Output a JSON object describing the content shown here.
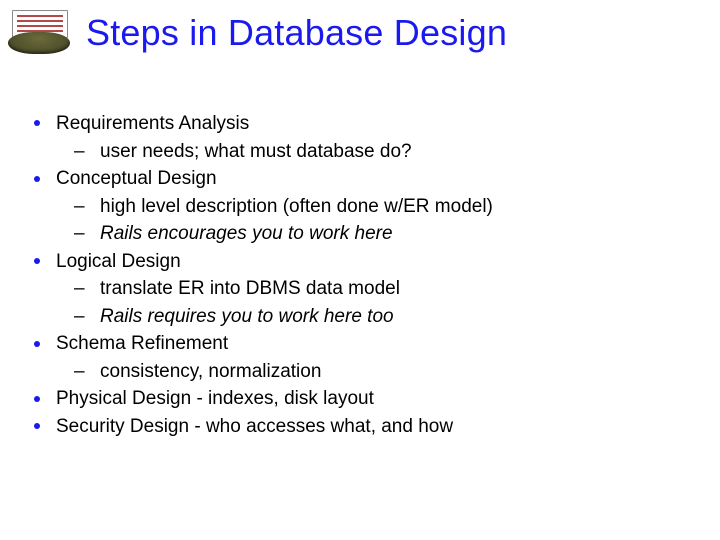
{
  "title": "Steps in Database Design",
  "bullets": {
    "b0": {
      "label": "Requirements Analysis",
      "sub": {
        "s0": "user needs; what must database do?"
      }
    },
    "b1": {
      "label": "Conceptual Design",
      "sub": {
        "s0": "high level description (often done w/ER model)",
        "s1": "Rails encourages you to work here"
      }
    },
    "b2": {
      "label": "Logical Design",
      "sub": {
        "s0": "translate ER into DBMS data model",
        "s1": "Rails requires you to work here too"
      }
    },
    "b3": {
      "label": "Schema Refinement",
      "sub": {
        "s0": "consistency, normalization"
      }
    },
    "b4": {
      "label": "Physical Design - indexes, disk layout"
    },
    "b5": {
      "label": "Security Design - who accesses what, and how"
    }
  }
}
